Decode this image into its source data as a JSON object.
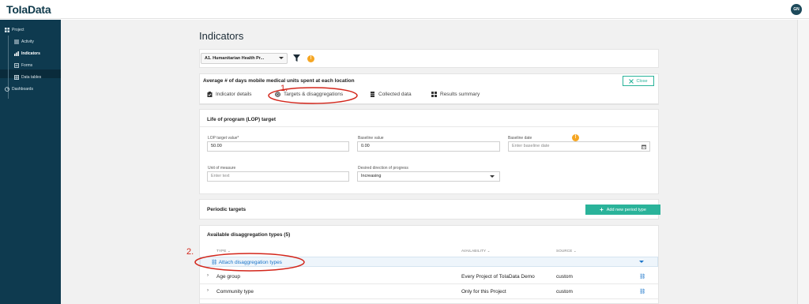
{
  "app": {
    "brand": "ToIaData",
    "user_initials": "GN"
  },
  "sidebar": {
    "project_label": "Project",
    "items": [
      {
        "label": "Activity",
        "icon": "activity-list-icon"
      },
      {
        "label": "Indicators",
        "icon": "bar-chart-icon",
        "active": true
      },
      {
        "label": "Forms",
        "icon": "form-icon"
      },
      {
        "label": "Data tables",
        "icon": "table-icon"
      }
    ],
    "dashboards_label": "Dashboards"
  },
  "page": {
    "title": "Indicators"
  },
  "filters": {
    "program_selected": "A1. Humanitarian Health Pr...",
    "info_badge": "!"
  },
  "indicator": {
    "name": "Average # of days mobile medical units spent at each location",
    "close_label": "Close"
  },
  "tabs": [
    {
      "label": "Indicator details",
      "icon": "clipboard-icon"
    },
    {
      "label": "Targets & disaggregations",
      "icon": "target-icon",
      "active": true
    },
    {
      "label": "Collected data",
      "icon": "database-icon"
    },
    {
      "label": "Results summary",
      "icon": "grid-icon"
    }
  ],
  "lop": {
    "title": "Life of program (LOP) target",
    "target_label": "LOP target value*",
    "target_value": "50.00",
    "baseline_label": "Baseline value",
    "baseline_value": "0.00",
    "baseline_date_label": "Baseline date",
    "baseline_date_placeholder": "Enter baseline date",
    "unit_label": "Unit of measure",
    "unit_placeholder": "Enter text",
    "direction_label": "Desired direction of progress",
    "direction_value": "Increasing"
  },
  "periodic": {
    "title": "Periodic targets",
    "add_label": "Add new period type"
  },
  "disagg": {
    "title": "Available disaggregation types (5)",
    "columns": {
      "type": "TYPE",
      "availability": "AVAILABILITY",
      "source": "SOURCE"
    },
    "attach_label": "Attach disaggregation types",
    "rows": [
      {
        "type": "Age group",
        "availability": "Every Project of ToIaData Demo",
        "source": "custom"
      },
      {
        "type": "Community type",
        "availability": "Only for this Project",
        "source": "custom"
      }
    ]
  },
  "annotations": {
    "step1": "1.",
    "step2": "2."
  },
  "colors": {
    "sidebar": "#0e3a4f",
    "accent": "#2ab39a",
    "link": "#1a74c9",
    "annotation": "#d3261b",
    "badge": "#f5a623"
  }
}
